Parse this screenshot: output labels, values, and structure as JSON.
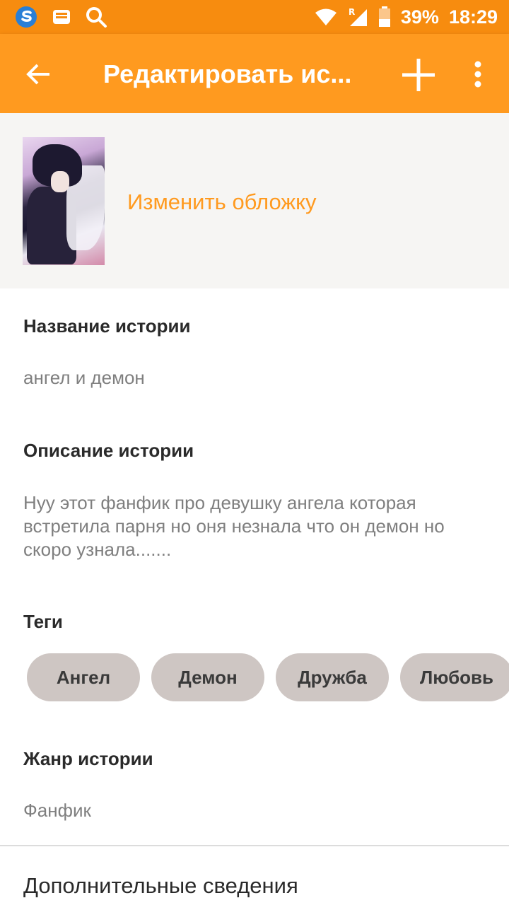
{
  "status_bar": {
    "battery": "39%",
    "time": "18:29",
    "icons": [
      "s-app-icon",
      "inbox-icon",
      "search-icon",
      "wifi-icon",
      "signal-icon",
      "battery-icon"
    ]
  },
  "app_bar": {
    "title": "Редактировать ис...",
    "icons": [
      "back-arrow-icon",
      "plus-icon",
      "more-vert-icon"
    ]
  },
  "cover": {
    "change_label": "Изменить обложку"
  },
  "story": {
    "title_label": "Название истории",
    "title_value": "ангел и демон",
    "description_label": "Описание истории",
    "description_lines": [
      "Нуу этот фанфик про девушку ангела которая",
      "встретила парня но оня незнала что он демон но",
      "скоро узнала......."
    ],
    "tags_label": "Теги",
    "tags": [
      "Ангел",
      "Демон",
      "Дружба",
      "Любовь"
    ],
    "genre_label": "Жанр истории",
    "genre_value": "Фанфик",
    "extra_label": "Дополнительные сведения"
  },
  "colors": {
    "app_bar": "#ff9a1f",
    "status_bar": "#f78c0f",
    "accent_text": "#ff9a1f",
    "tag_bg": "#cec6c3"
  }
}
